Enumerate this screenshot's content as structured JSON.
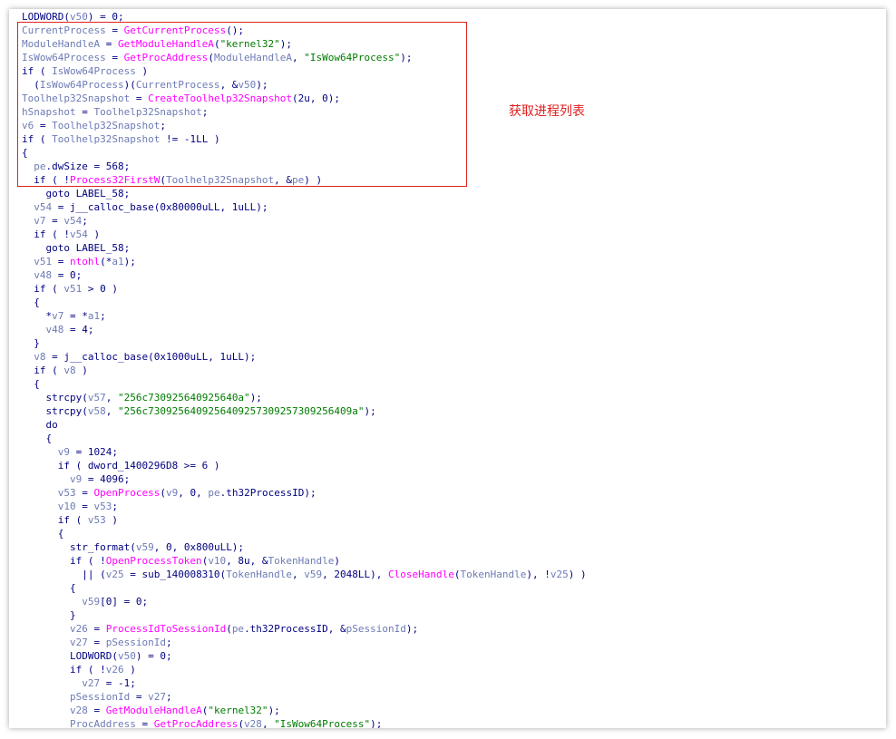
{
  "annotation": {
    "label": "获取进程列表",
    "color": "#e02020"
  },
  "colors": {
    "keyword": "#000080",
    "variable": "#6e7bb5",
    "function": "#ff00ff",
    "string": "#007a00",
    "background": "#ffffff"
  },
  "code_lines": [
    [
      [
        "k",
        "LODWORD("
      ],
      [
        "v",
        "v50"
      ],
      [
        "k",
        ") = 0;"
      ]
    ],
    [
      [
        "v",
        "CurrentProcess"
      ],
      [
        "k",
        " = "
      ],
      [
        "f",
        "GetCurrentProcess"
      ],
      [
        "k",
        "();"
      ]
    ],
    [
      [
        "v",
        "ModuleHandleA"
      ],
      [
        "k",
        " = "
      ],
      [
        "f",
        "GetModuleHandleA"
      ],
      [
        "k",
        "("
      ],
      [
        "s",
        "\"kernel32\""
      ],
      [
        "k",
        ");"
      ]
    ],
    [
      [
        "v",
        "IsWow64Process"
      ],
      [
        "k",
        " = "
      ],
      [
        "f",
        "GetProcAddress"
      ],
      [
        "k",
        "("
      ],
      [
        "v",
        "ModuleHandleA"
      ],
      [
        "k",
        ", "
      ],
      [
        "s",
        "\"IsWow64Process\""
      ],
      [
        "k",
        ");"
      ]
    ],
    [
      [
        "k",
        "if ( "
      ],
      [
        "v",
        "IsWow64Process"
      ],
      [
        "k",
        " )"
      ]
    ],
    [
      [
        "k",
        "  ("
      ],
      [
        "v",
        "IsWow64Process"
      ],
      [
        "k",
        ")("
      ],
      [
        "v",
        "CurrentProcess"
      ],
      [
        "k",
        ", &"
      ],
      [
        "v",
        "v50"
      ],
      [
        "k",
        ");"
      ]
    ],
    [
      [
        "v",
        "Toolhelp32Snapshot"
      ],
      [
        "k",
        " = "
      ],
      [
        "f",
        "CreateToolhelp32Snapshot"
      ],
      [
        "k",
        "(2u, 0);"
      ]
    ],
    [
      [
        "v",
        "hSnapshot"
      ],
      [
        "k",
        " = "
      ],
      [
        "v",
        "Toolhelp32Snapshot"
      ],
      [
        "k",
        ";"
      ]
    ],
    [
      [
        "v",
        "v6"
      ],
      [
        "k",
        " = "
      ],
      [
        "v",
        "Toolhelp32Snapshot"
      ],
      [
        "k",
        ";"
      ]
    ],
    [
      [
        "k",
        "if ( "
      ],
      [
        "v",
        "Toolhelp32Snapshot"
      ],
      [
        "k",
        " != -1LL )"
      ]
    ],
    [
      [
        "k",
        "{"
      ]
    ],
    [
      [
        "k",
        "  "
      ],
      [
        "v",
        "pe"
      ],
      [
        "k",
        ".dwSize = 568;"
      ]
    ],
    [
      [
        "k",
        "  if ( !"
      ],
      [
        "f",
        "Process32FirstW"
      ],
      [
        "k",
        "("
      ],
      [
        "v",
        "Toolhelp32Snapshot"
      ],
      [
        "k",
        ", &"
      ],
      [
        "v",
        "pe"
      ],
      [
        "k",
        ") )"
      ]
    ],
    [
      [
        "k",
        "    goto LABEL_58;"
      ]
    ],
    [
      [
        "k",
        "  "
      ],
      [
        "v",
        "v54"
      ],
      [
        "k",
        " = j__calloc_base(0x80000uLL, 1uLL);"
      ]
    ],
    [
      [
        "k",
        "  "
      ],
      [
        "v",
        "v7"
      ],
      [
        "k",
        " = "
      ],
      [
        "v",
        "v54"
      ],
      [
        "k",
        ";"
      ]
    ],
    [
      [
        "k",
        "  if ( !"
      ],
      [
        "v",
        "v54"
      ],
      [
        "k",
        " )"
      ]
    ],
    [
      [
        "k",
        "    goto LABEL_58;"
      ]
    ],
    [
      [
        "k",
        "  "
      ],
      [
        "v",
        "v51"
      ],
      [
        "k",
        " = "
      ],
      [
        "f",
        "ntohl"
      ],
      [
        "k",
        "(*"
      ],
      [
        "v",
        "a1"
      ],
      [
        "k",
        ");"
      ]
    ],
    [
      [
        "k",
        "  "
      ],
      [
        "v",
        "v48"
      ],
      [
        "k",
        " = 0;"
      ]
    ],
    [
      [
        "k",
        "  if ( "
      ],
      [
        "v",
        "v51"
      ],
      [
        "k",
        " > 0 )"
      ]
    ],
    [
      [
        "k",
        "  {"
      ]
    ],
    [
      [
        "k",
        "    *"
      ],
      [
        "v",
        "v7"
      ],
      [
        "k",
        " = *"
      ],
      [
        "v",
        "a1"
      ],
      [
        "k",
        ";"
      ]
    ],
    [
      [
        "k",
        "    "
      ],
      [
        "v",
        "v48"
      ],
      [
        "k",
        " = 4;"
      ]
    ],
    [
      [
        "k",
        "  }"
      ]
    ],
    [
      [
        "k",
        "  "
      ],
      [
        "v",
        "v8"
      ],
      [
        "k",
        " = j__calloc_base(0x1000uLL, 1uLL);"
      ]
    ],
    [
      [
        "k",
        "  if ( "
      ],
      [
        "v",
        "v8"
      ],
      [
        "k",
        " )"
      ]
    ],
    [
      [
        "k",
        "  {"
      ]
    ],
    [
      [
        "k",
        "    strcpy("
      ],
      [
        "v",
        "v57"
      ],
      [
        "k",
        ", "
      ],
      [
        "s",
        "\"256c730925640925640a\""
      ],
      [
        "k",
        ");"
      ]
    ],
    [
      [
        "k",
        "    strcpy("
      ],
      [
        "v",
        "v58"
      ],
      [
        "k",
        ", "
      ],
      [
        "s",
        "\"256c7309256409256409257309257309256409a\""
      ],
      [
        "k",
        ");"
      ]
    ],
    [
      [
        "k",
        "    do"
      ]
    ],
    [
      [
        "k",
        "    {"
      ]
    ],
    [
      [
        "k",
        "      "
      ],
      [
        "v",
        "v9"
      ],
      [
        "k",
        " = 1024;"
      ]
    ],
    [
      [
        "k",
        "      if ( dword_1400296D8 >= 6 )"
      ]
    ],
    [
      [
        "k",
        "        "
      ],
      [
        "v",
        "v9"
      ],
      [
        "k",
        " = 4096;"
      ]
    ],
    [
      [
        "k",
        "      "
      ],
      [
        "v",
        "v53"
      ],
      [
        "k",
        " = "
      ],
      [
        "f",
        "OpenProcess"
      ],
      [
        "k",
        "("
      ],
      [
        "v",
        "v9"
      ],
      [
        "k",
        ", 0, "
      ],
      [
        "v",
        "pe"
      ],
      [
        "k",
        ".th32ProcessID);"
      ]
    ],
    [
      [
        "k",
        "      "
      ],
      [
        "v",
        "v10"
      ],
      [
        "k",
        " = "
      ],
      [
        "v",
        "v53"
      ],
      [
        "k",
        ";"
      ]
    ],
    [
      [
        "k",
        "      if ( "
      ],
      [
        "v",
        "v53"
      ],
      [
        "k",
        " )"
      ]
    ],
    [
      [
        "k",
        "      {"
      ]
    ],
    [
      [
        "k",
        "        str_format("
      ],
      [
        "v",
        "v59"
      ],
      [
        "k",
        ", 0, 0x800uLL);"
      ]
    ],
    [
      [
        "k",
        "        if ( !"
      ],
      [
        "f",
        "OpenProcessToken"
      ],
      [
        "k",
        "("
      ],
      [
        "v",
        "v10"
      ],
      [
        "k",
        ", 8u, &"
      ],
      [
        "v",
        "TokenHandle"
      ],
      [
        "k",
        ")"
      ]
    ],
    [
      [
        "k",
        "          || ("
      ],
      [
        "v",
        "v25"
      ],
      [
        "k",
        " = sub_140008310("
      ],
      [
        "v",
        "TokenHandle"
      ],
      [
        "k",
        ", "
      ],
      [
        "v",
        "v59"
      ],
      [
        "k",
        ", 2048LL), "
      ],
      [
        "f",
        "CloseHandle"
      ],
      [
        "k",
        "("
      ],
      [
        "v",
        "TokenHandle"
      ],
      [
        "k",
        "), !"
      ],
      [
        "v",
        "v25"
      ],
      [
        "k",
        ") )"
      ]
    ],
    [
      [
        "k",
        "        {"
      ]
    ],
    [
      [
        "k",
        "          "
      ],
      [
        "v",
        "v59"
      ],
      [
        "k",
        "[0] = 0;"
      ]
    ],
    [
      [
        "k",
        "        }"
      ]
    ],
    [
      [
        "k",
        "        "
      ],
      [
        "v",
        "v26"
      ],
      [
        "k",
        " = "
      ],
      [
        "f",
        "ProcessIdToSessionId"
      ],
      [
        "k",
        "("
      ],
      [
        "v",
        "pe"
      ],
      [
        "k",
        ".th32ProcessID, &"
      ],
      [
        "v",
        "pSessionId"
      ],
      [
        "k",
        ");"
      ]
    ],
    [
      [
        "k",
        "        "
      ],
      [
        "v",
        "v27"
      ],
      [
        "k",
        " = "
      ],
      [
        "v",
        "pSessionId"
      ],
      [
        "k",
        ";"
      ]
    ],
    [
      [
        "k",
        "        LODWORD("
      ],
      [
        "v",
        "v50"
      ],
      [
        "k",
        ") = 0;"
      ]
    ],
    [
      [
        "k",
        "        if ( !"
      ],
      [
        "v",
        "v26"
      ],
      [
        "k",
        " )"
      ]
    ],
    [
      [
        "k",
        "          "
      ],
      [
        "v",
        "v27"
      ],
      [
        "k",
        " = -1;"
      ]
    ],
    [
      [
        "k",
        "        "
      ],
      [
        "v",
        "pSessionId"
      ],
      [
        "k",
        " = "
      ],
      [
        "v",
        "v27"
      ],
      [
        "k",
        ";"
      ]
    ],
    [
      [
        "k",
        "        "
      ],
      [
        "v",
        "v28"
      ],
      [
        "k",
        " = "
      ],
      [
        "f",
        "GetModuleHandleA"
      ],
      [
        "k",
        "("
      ],
      [
        "s",
        "\"kernel32\""
      ],
      [
        "k",
        ");"
      ]
    ],
    [
      [
        "k",
        "        "
      ],
      [
        "v",
        "ProcAddress"
      ],
      [
        "k",
        " = "
      ],
      [
        "f",
        "GetProcAddress"
      ],
      [
        "k",
        "("
      ],
      [
        "v",
        "v28"
      ],
      [
        "k",
        ", "
      ],
      [
        "s",
        "\"IsWow64Process\""
      ],
      [
        "k",
        ");"
      ]
    ]
  ]
}
